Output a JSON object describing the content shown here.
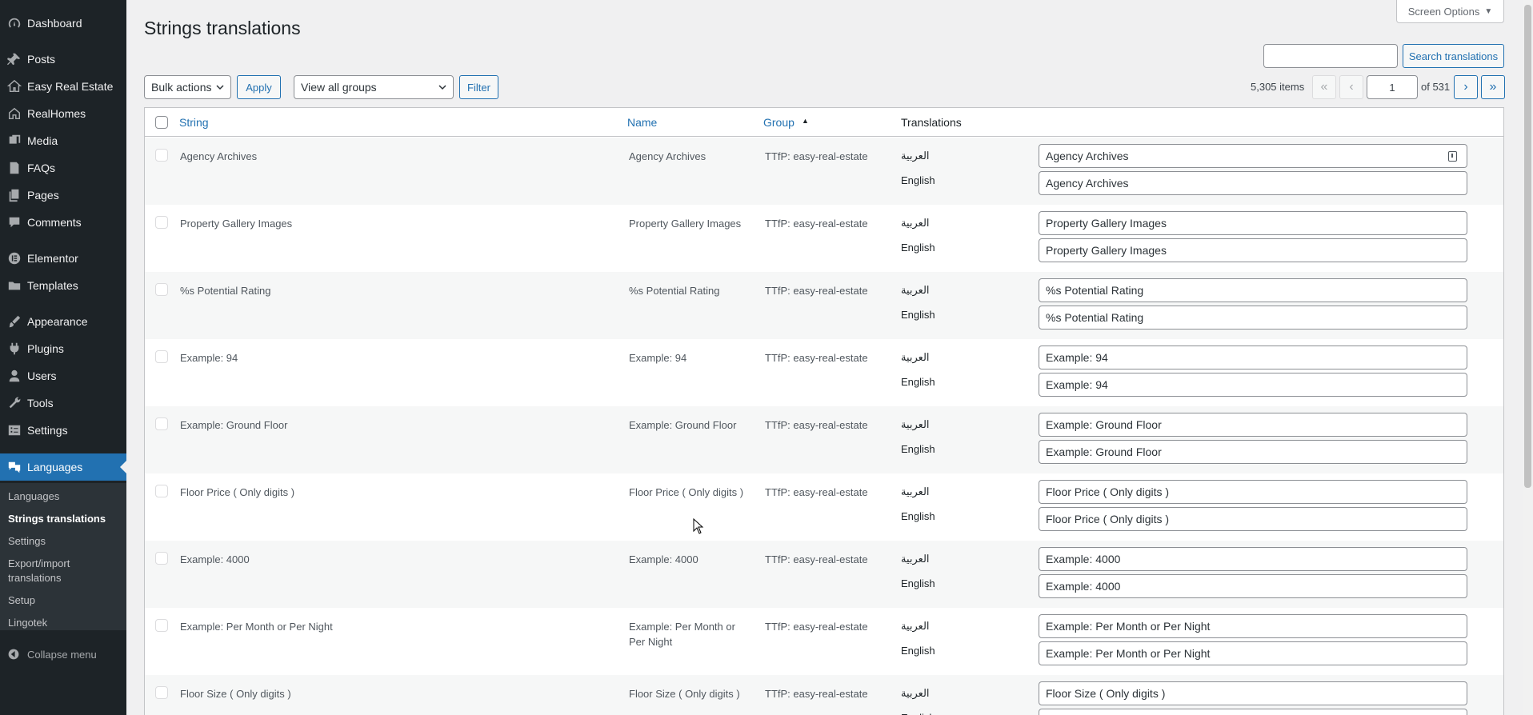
{
  "sidebar": {
    "items": [
      {
        "label": "Dashboard",
        "icon": "dashboard-icon"
      },
      {
        "label": "Posts",
        "icon": "pin-icon"
      },
      {
        "label": "Easy Real Estate",
        "icon": "house-icon"
      },
      {
        "label": "RealHomes",
        "icon": "home-icon"
      },
      {
        "label": "Media",
        "icon": "media-icon"
      },
      {
        "label": "FAQs",
        "icon": "document-icon"
      },
      {
        "label": "Pages",
        "icon": "pages-icon"
      },
      {
        "label": "Comments",
        "icon": "comment-icon"
      },
      {
        "label": "Elementor",
        "icon": "elementor-icon"
      },
      {
        "label": "Templates",
        "icon": "folder-icon"
      },
      {
        "label": "Appearance",
        "icon": "brush-icon"
      },
      {
        "label": "Plugins",
        "icon": "plug-icon"
      },
      {
        "label": "Users",
        "icon": "user-icon"
      },
      {
        "label": "Tools",
        "icon": "wrench-icon"
      },
      {
        "label": "Settings",
        "icon": "sliders-icon"
      },
      {
        "label": "Languages",
        "icon": "translate-icon"
      }
    ],
    "submenu": [
      "Languages",
      "Strings translations",
      "Settings",
      "Export/import translations",
      "Setup",
      "Lingotek"
    ],
    "collapse_label": "Collapse menu"
  },
  "header": {
    "title": "Strings translations",
    "screen_options": "Screen Options",
    "search_button": "Search translations",
    "search_value": ""
  },
  "toolbar": {
    "bulk_actions": "Bulk actions",
    "apply": "Apply",
    "group_filter": "View all groups",
    "filter": "Filter"
  },
  "pagination": {
    "items": "5,305 items",
    "first": "«",
    "prev": "‹",
    "current_page": "1",
    "of_pages": "of 531",
    "next": "›",
    "last": "»"
  },
  "table": {
    "columns": [
      "String",
      "Name",
      "Group",
      "Translations"
    ],
    "sort_indicator": "▲",
    "lang_ar": "العربية",
    "lang_en": "English",
    "rows": [
      {
        "string": "Agency Archives",
        "name": "Agency Archives",
        "group": "TTfP: easy-real-estate",
        "ar": "Agency Archives",
        "en": "Agency Archives"
      },
      {
        "string": "Property Gallery Images",
        "name": "Property Gallery Images",
        "group": "TTfP: easy-real-estate",
        "ar": "Property Gallery Images",
        "en": "Property Gallery Images"
      },
      {
        "string": "%s Potential Rating",
        "name": "%s Potential Rating",
        "group": "TTfP: easy-real-estate",
        "ar": "%s Potential Rating",
        "en": "%s Potential Rating"
      },
      {
        "string": "Example: 94",
        "name": "Example: 94",
        "group": "TTfP: easy-real-estate",
        "ar": "Example: 94",
        "en": "Example: 94"
      },
      {
        "string": "Example: Ground Floor",
        "name": "Example: Ground Floor",
        "group": "TTfP: easy-real-estate",
        "ar": "Example: Ground Floor",
        "en": "Example: Ground Floor"
      },
      {
        "string": "Floor Price ( Only digits )",
        "name": "Floor Price ( Only digits )",
        "group": "TTfP: easy-real-estate",
        "ar": "Floor Price ( Only digits )",
        "en": "Floor Price ( Only digits )"
      },
      {
        "string": "Example: 4000",
        "name": "Example: 4000",
        "group": "TTfP: easy-real-estate",
        "ar": "Example: 4000",
        "en": "Example: 4000"
      },
      {
        "string": "Example: Per Month or Per Night",
        "name": "Example: Per Month or Per Night",
        "group": "TTfP: easy-real-estate",
        "ar": "Example: Per Month or Per Night",
        "en": "Example: Per Month or Per Night"
      },
      {
        "string": "Floor Size ( Only digits )",
        "name": "Floor Size ( Only digits )",
        "group": "TTfP: easy-real-estate",
        "ar": "Floor Size ( Only digits )",
        "en": ""
      }
    ]
  },
  "colors": {
    "sidebar_bg": "#1d2327",
    "accent": "#2271b1",
    "page_bg": "#f0f0f1"
  }
}
